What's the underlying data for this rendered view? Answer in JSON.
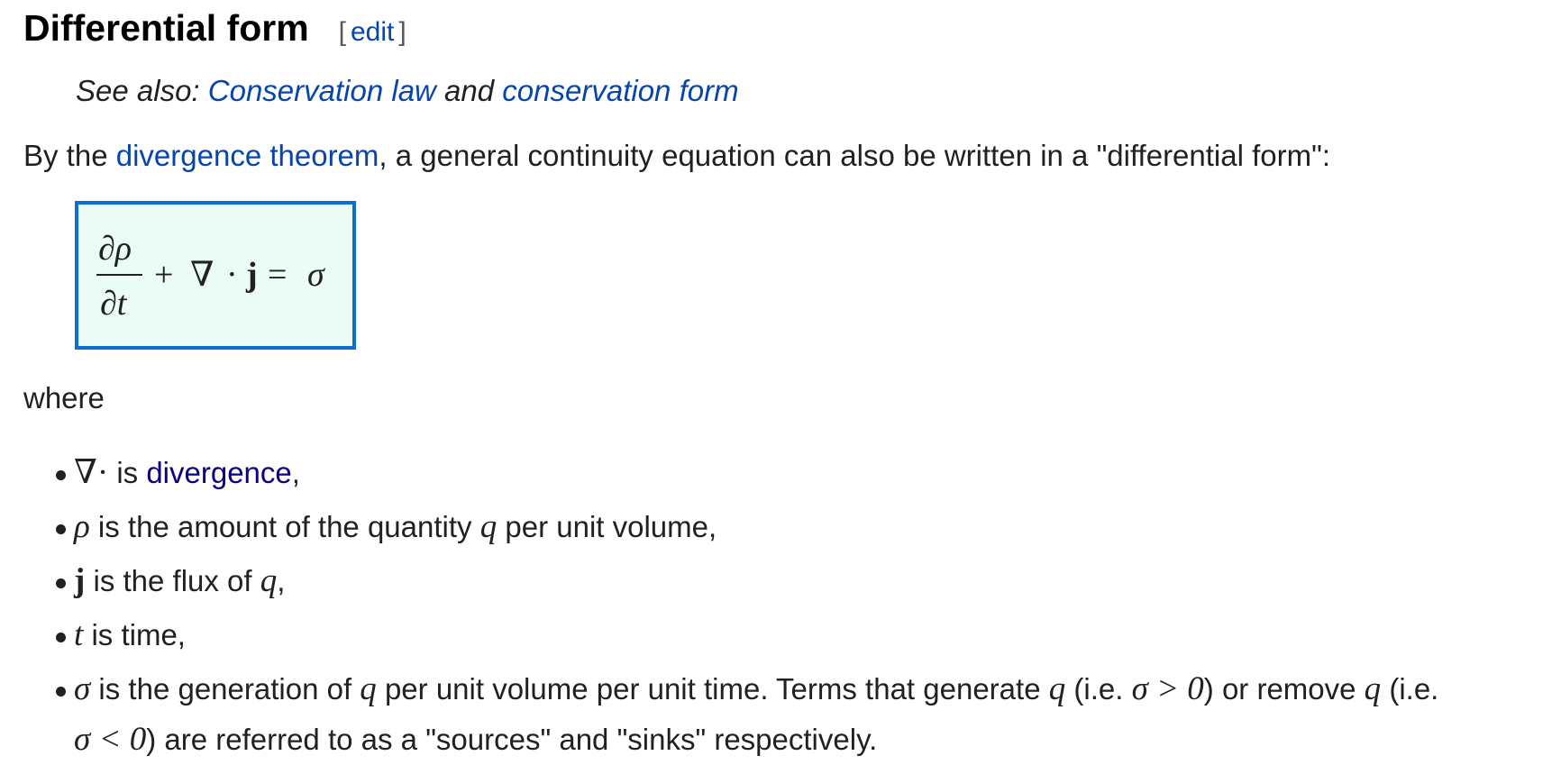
{
  "section": {
    "title": "Differential form",
    "edit_open": "[",
    "edit_label": "edit",
    "edit_close": "]"
  },
  "hatnote": {
    "prefix": "See also: ",
    "link1": "Conservation law",
    "middle": " and ",
    "link2": "conservation form"
  },
  "intro": {
    "before": "By the ",
    "link": "divergence theorem",
    "after": ", a general continuity equation can also be written in a \"differential form\":"
  },
  "equation": {
    "numerator": "∂ρ",
    "denominator": "∂t",
    "plus": "+",
    "nabla": "∇",
    "dot": "·",
    "j": "j",
    "equals": "=",
    "sigma": "σ"
  },
  "where_label": "where",
  "bullets": [
    {
      "sym": "∇·",
      "text1": " is ",
      "link": "divergence",
      "text2": ","
    },
    {
      "sym": "ρ",
      "text1": " is the amount of the quantity ",
      "var": "q",
      "text2": " per unit volume,"
    },
    {
      "sym": "j",
      "text1": " is the flux of ",
      "var": "q",
      "text2": ","
    },
    {
      "sym": "t",
      "text1": " is time,"
    },
    {
      "sym": "σ",
      "text1": " is the generation of ",
      "var1": "q",
      "text2": " per unit volume per unit time. Terms that generate ",
      "var2": "q",
      "text3": " (i.e. ",
      "cond1": "σ > 0",
      "text4": ") or remove ",
      "var3": "q",
      "text5": " (i.e.",
      "cond2": "σ < 0",
      "text6": ") are referred to as a \"sources\" and \"sinks\" respectively."
    }
  ],
  "colors": {
    "link": "#0645ad",
    "visited_link": "#0b0080",
    "box_border": "#0b6fd1",
    "box_fill": "#ebfbf5"
  }
}
